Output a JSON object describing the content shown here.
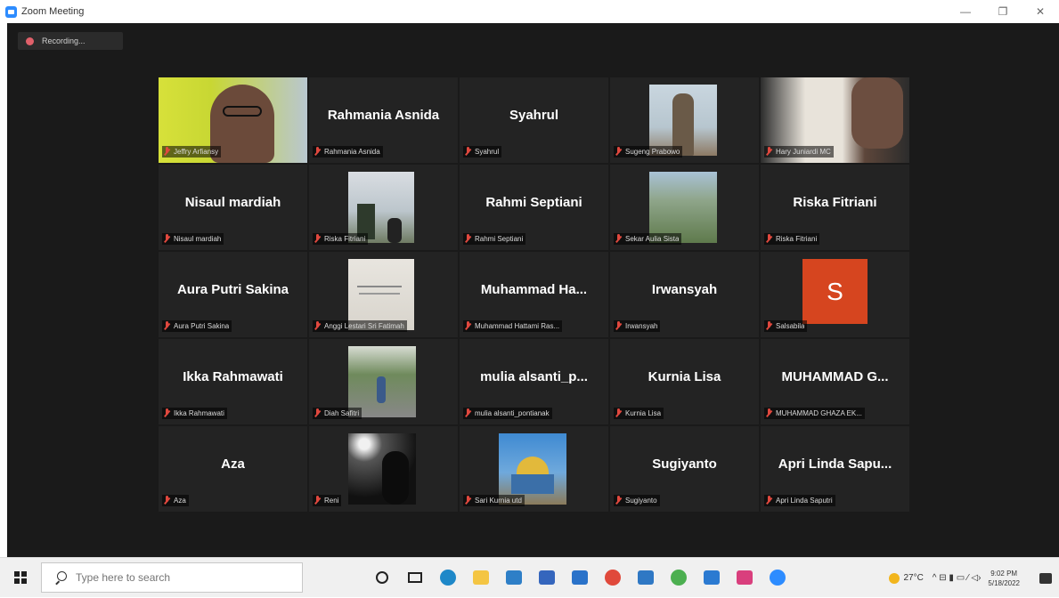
{
  "window": {
    "title": "Zoom Meeting",
    "minimize": "—",
    "restore": "❐",
    "close": "✕"
  },
  "recording": {
    "label": "Recording..."
  },
  "participants": [
    {
      "big": "",
      "tag": "Jeffry Arfiansy",
      "video": "man-glasses",
      "active": true
    },
    {
      "big": "Rahmania Asnida",
      "tag": "Rahmania Asnida"
    },
    {
      "big": "Syahrul",
      "tag": "Syahrul"
    },
    {
      "big": "",
      "tag": "Sugeng Prabowo",
      "video": "man-standing"
    },
    {
      "big": "",
      "tag": "Hary Juniardi MC",
      "video": "man-face"
    },
    {
      "big": "Nisaul mardiah",
      "tag": "Nisaul mardiah"
    },
    {
      "big": "",
      "tag": "Riska Fitriani",
      "video": "beach"
    },
    {
      "big": "Rahmi Septiani",
      "tag": "Rahmi Septiani"
    },
    {
      "big": "",
      "tag": "Sekar Aulia Sista",
      "video": "landscape"
    },
    {
      "big": "Riska Fitriani",
      "tag": "Riska Fitriani"
    },
    {
      "big": "Aura Putri Sakina",
      "tag": "Aura Putri Sakina"
    },
    {
      "big": "",
      "tag": "Anggi Lestari Sri Fatimah",
      "video": "document"
    },
    {
      "big": "Muhammad  Ha...",
      "tag": "Muhammad Hattami Ras..."
    },
    {
      "big": "Irwansyah",
      "tag": "Irwansyah"
    },
    {
      "big": "",
      "tag": "Salsabila",
      "avatar": "S"
    },
    {
      "big": "Ikka Rahmawati",
      "tag": "Ikka Rahmawati"
    },
    {
      "big": "",
      "tag": "Diah Safitri",
      "video": "street"
    },
    {
      "big": "mulia alsanti_p...",
      "tag": "mulia alsanti_pontianak"
    },
    {
      "big": "Kurnia Lisa",
      "tag": "Kurnia Lisa"
    },
    {
      "big": "MUHAMMAD  G...",
      "tag": "MUHAMMAD GHAZA EK..."
    },
    {
      "big": "Aza",
      "tag": "Aza"
    },
    {
      "big": "",
      "tag": "Reni",
      "video": "dark-room"
    },
    {
      "big": "",
      "tag": "Sari Kurnia utd",
      "video": "mosque"
    },
    {
      "big": "Sugiyanto",
      "tag": "Sugiyanto"
    },
    {
      "big": "Apri Linda Sapu...",
      "tag": "Apri Linda Saputri"
    }
  ],
  "taskbar": {
    "search_placeholder": "Type here to search",
    "temperature": "27°C",
    "tray_icons": "^  ⊟  ▮  ▭  ⁄  ◁›",
    "time": "9:02 PM",
    "date": "5/18/2022"
  },
  "colors": {
    "meeting_bg": "#1a1a1a",
    "tile_bg": "#232323",
    "active_speaker": "#cfe64e",
    "muted_mic": "#e0483e",
    "avatar_orange": "#d6451f"
  }
}
